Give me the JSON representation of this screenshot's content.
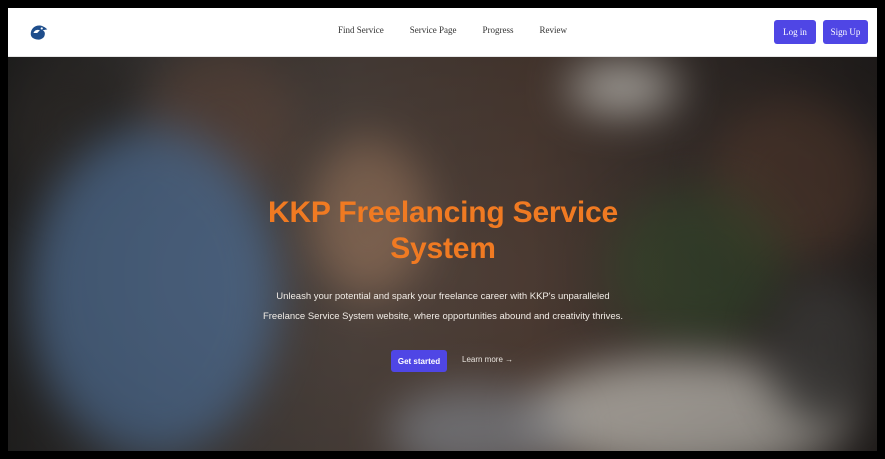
{
  "header": {
    "logo_icon": "bird-logo-icon",
    "nav": [
      {
        "label": "Find Service"
      },
      {
        "label": "Service Page"
      },
      {
        "label": "Progress"
      },
      {
        "label": "Review"
      }
    ],
    "login_label": "Log in",
    "signup_label": "Sign Up"
  },
  "hero": {
    "title_line1": "KKP Freelancing Service",
    "title_line2": "System",
    "subtitle_line1": "Unleash your potential and spark your freelance career with KKP's unparalleled",
    "subtitle_line2": "Freelance Service System website, where opportunities abound and creativity thrives.",
    "cta_label": "Get started",
    "learn_label": "Learn more",
    "learn_arrow": "→"
  },
  "colors": {
    "accent": "#4f46e5",
    "title": "#f07a22"
  }
}
